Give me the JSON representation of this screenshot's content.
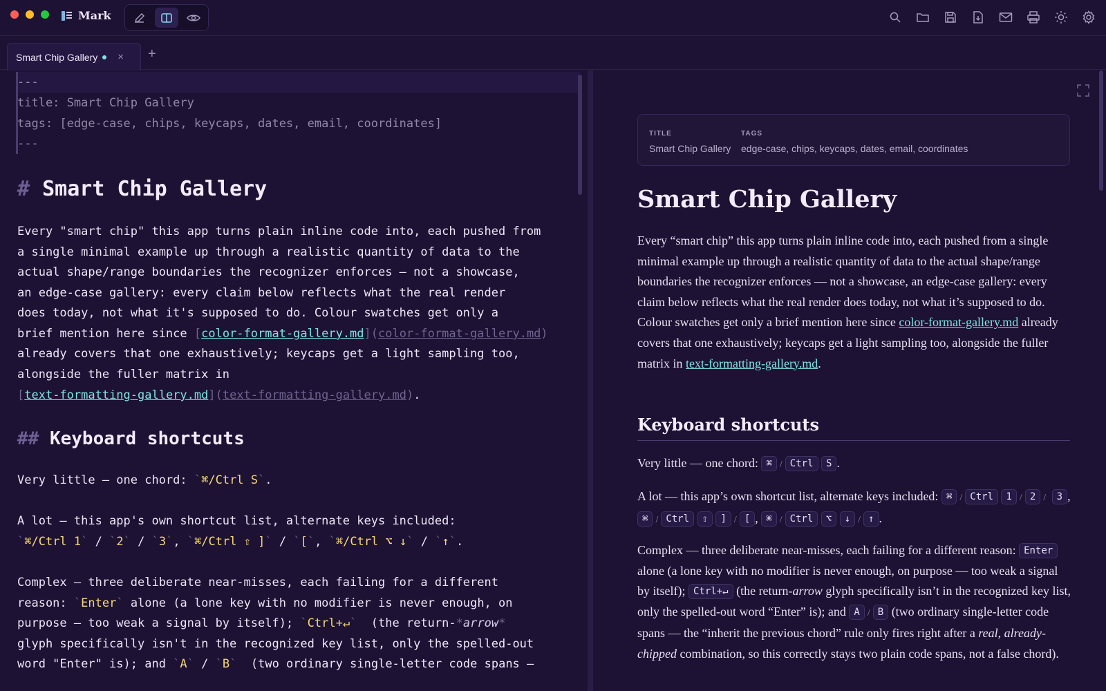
{
  "app": {
    "name": "Mark"
  },
  "modes": [
    "edit-icon",
    "split-icon",
    "preview-icon"
  ],
  "toolbar_icons": [
    "search-icon",
    "folder-icon",
    "save-icon",
    "export-icon",
    "mail-icon",
    "print-icon",
    "theme-icon",
    "settings-icon"
  ],
  "tab": {
    "label": "Smart Chip Gallery",
    "close": "×",
    "add": "+"
  },
  "editor": {
    "fm_open": "---",
    "fm_title": "title: Smart Chip Gallery",
    "fm_tags": "tags: [edge-case, chips, keycaps, dates, email, coordinates]",
    "fm_close": "---",
    "h1_mark": "#",
    "h1": "Smart Chip Gallery",
    "p1": [
      "Every \"smart chip\" this app turns plain inline code into, each pushed from",
      "a single minimal example up through a realistic quantity of data to the",
      "actual shape/range boundaries the recognizer enforces — not a showcase,",
      "an edge-case gallery: every claim below reflects what the real render",
      "does today, not what it's supposed to do. Colour swatches get only a"
    ],
    "p1_l6_pre": "brief mention here since ",
    "link1_text": "color-format-gallery.md",
    "link1_url": "color-format-gallery.md",
    "p1_l7": "already covers that one exhaustively; keycaps get a light sampling too,",
    "p1_l8": "alongside the fuller matrix in",
    "link2_text": "text-formatting-gallery.md",
    "link2_url": "text-formatting-gallery.md",
    "h2_mark": "##",
    "h2": "Keyboard shortcuts",
    "vl_pre": "Very little — one chord: ",
    "vl_code": "⌘/Ctrl S",
    "al_l1": "A lot — this app's own shortcut list, alternate keys included:",
    "al_c1": "⌘/Ctrl 1",
    "al_c2": "2",
    "al_c3": "3",
    "al_c4": "⌘/Ctrl ⇧ ]",
    "al_c5": "[",
    "al_c6": "⌘/Ctrl ⌥ ↓",
    "al_c7": "↑",
    "cx_l1": "Complex — three deliberate near-misses, each failing for a different",
    "cx_l2_pre": "reason: ",
    "cx_enter": "Enter",
    "cx_l2_post": " alone (a lone key with no modifier is never enough, on",
    "cx_l3_pre": "purpose — too weak a signal by itself); ",
    "cx_ctrl": "Ctrl+↵",
    "cx_l3_mid": "  (the return-",
    "cx_arrow": "arrow",
    "cx_l4": "glyph specifically isn't in the recognized key list, only the spelled-out",
    "cx_l5_pre": "word \"Enter\" is); and ",
    "cx_a": "A",
    "cx_b": "B",
    "cx_l5_post": "  (two ordinary single-letter code spans —"
  },
  "preview": {
    "meta": {
      "title_key": "TITLE",
      "title_val": "Smart Chip Gallery",
      "tags_key": "TAGS",
      "tags_val": "edge-case, chips, keycaps, dates, email, coordinates"
    },
    "h1": "Smart Chip Gallery",
    "p1_a": "Every “smart chip” this app turns plain inline code into, each pushed from a single minimal example up through a realistic quantity of data to the actual shape/range boundaries the recognizer enforces — not a showcase, an edge-case gallery: every claim below reflects what the real render does today, not what it’s supposed to do. Colour swatches get only a brief mention here since ",
    "p1_link1": "color-format-gallery.md",
    "p1_b": " already covers that one exhaustively; keycaps get a light sampling too, alongside the fuller matrix in ",
    "p1_link2": "text-formatting-gallery.md",
    "p1_c": ".",
    "h2": "Keyboard shortcuts",
    "vl": "Very little — one chord:",
    "vl_keys": [
      "⌘",
      "Ctrl",
      "S"
    ],
    "al": "A lot — this app’s own shortcut list, alternate keys included:",
    "al_keys": [
      "⌘",
      "Ctrl",
      "1",
      "2",
      "3",
      "⌘",
      "Ctrl",
      "⇧",
      "]",
      "[",
      "⌘",
      "Ctrl",
      "⌥",
      "↓",
      "↑"
    ],
    "cx_a": "Complex — three deliberate near-misses, each failing for a different reason:",
    "cx_enter": "Enter",
    "cx_b": "alone (a lone key with no modifier is never enough, on purpose — too weak a signal by itself);",
    "cx_ctrl": "Ctrl+↵",
    "cx_c": "(the return-",
    "cx_arrow": "arrow",
    "cx_d": " glyph specifically isn’t in the recognized key list, only the spelled-out word “Enter” is); and",
    "cx_keyA": "A",
    "cx_keyB": "B",
    "cx_e": "(two ordinary single-letter code spans — the “inherit the previous chord” rule only fires right after a",
    "cx_real": "real, already-chipped",
    "cx_f": " combination, so this correctly stays two plain code spans, not a false chord)."
  }
}
